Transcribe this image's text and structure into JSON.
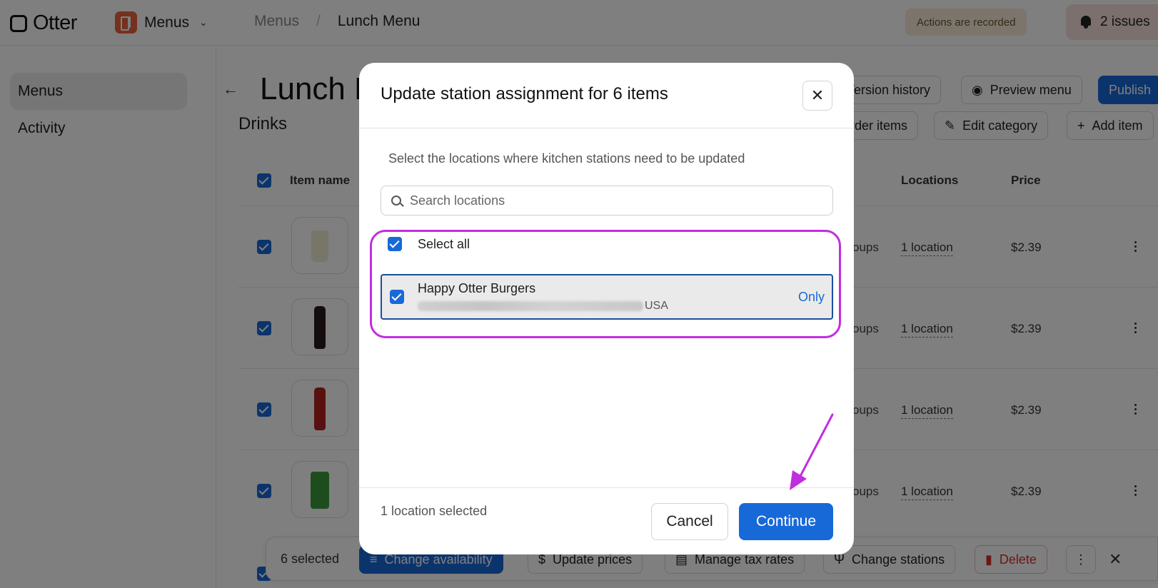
{
  "topbar": {
    "logo_text": "Otter",
    "app_label": "Menus",
    "breadcrumb": [
      "Menus",
      "/",
      "Lunch Menu"
    ],
    "recorded_badge": "Actions are recorded",
    "issues_label": "2 issues"
  },
  "sidebar": {
    "items": [
      {
        "label": "Menus",
        "active": true
      },
      {
        "label": "Activity",
        "active": false
      }
    ]
  },
  "main": {
    "title": "Lunch M",
    "header_buttons": [
      "Version history",
      "Preview menu",
      "Publish"
    ],
    "section_title": "Drinks",
    "section_buttons": [
      "rder items",
      "Edit category",
      "Add item"
    ],
    "columns": [
      "Item name",
      "Locations",
      "Price"
    ],
    "rows": [
      {
        "modifier": "oups",
        "locations": "1 location",
        "price": "$2.39"
      },
      {
        "modifier": "oups",
        "locations": "1 location",
        "price": "$2.39"
      },
      {
        "modifier": "oups",
        "locations": "1 location",
        "price": "$2.39"
      },
      {
        "modifier": "oups",
        "locations": "1 location",
        "price": "$2.39"
      }
    ]
  },
  "action_bar": {
    "selected_count": "6 selected",
    "buttons": [
      "Change availability",
      "Update prices",
      "Manage tax rates",
      "Change stations",
      "Delete"
    ]
  },
  "modal": {
    "title": "Update station assignment for 6 items",
    "subtitle": "Select the locations where kitchen stations need to be updated",
    "search_placeholder": "Search locations",
    "select_all_label": "Select all",
    "location": {
      "name": "Happy Otter Burgers",
      "address_suffix": "USA",
      "only_label": "Only"
    },
    "selected_count": "1 location selected",
    "cancel_label": "Cancel",
    "continue_label": "Continue"
  },
  "colors": {
    "accent": "#1869d8",
    "highlight": "#c12ee0",
    "danger": "#d92c2c"
  }
}
